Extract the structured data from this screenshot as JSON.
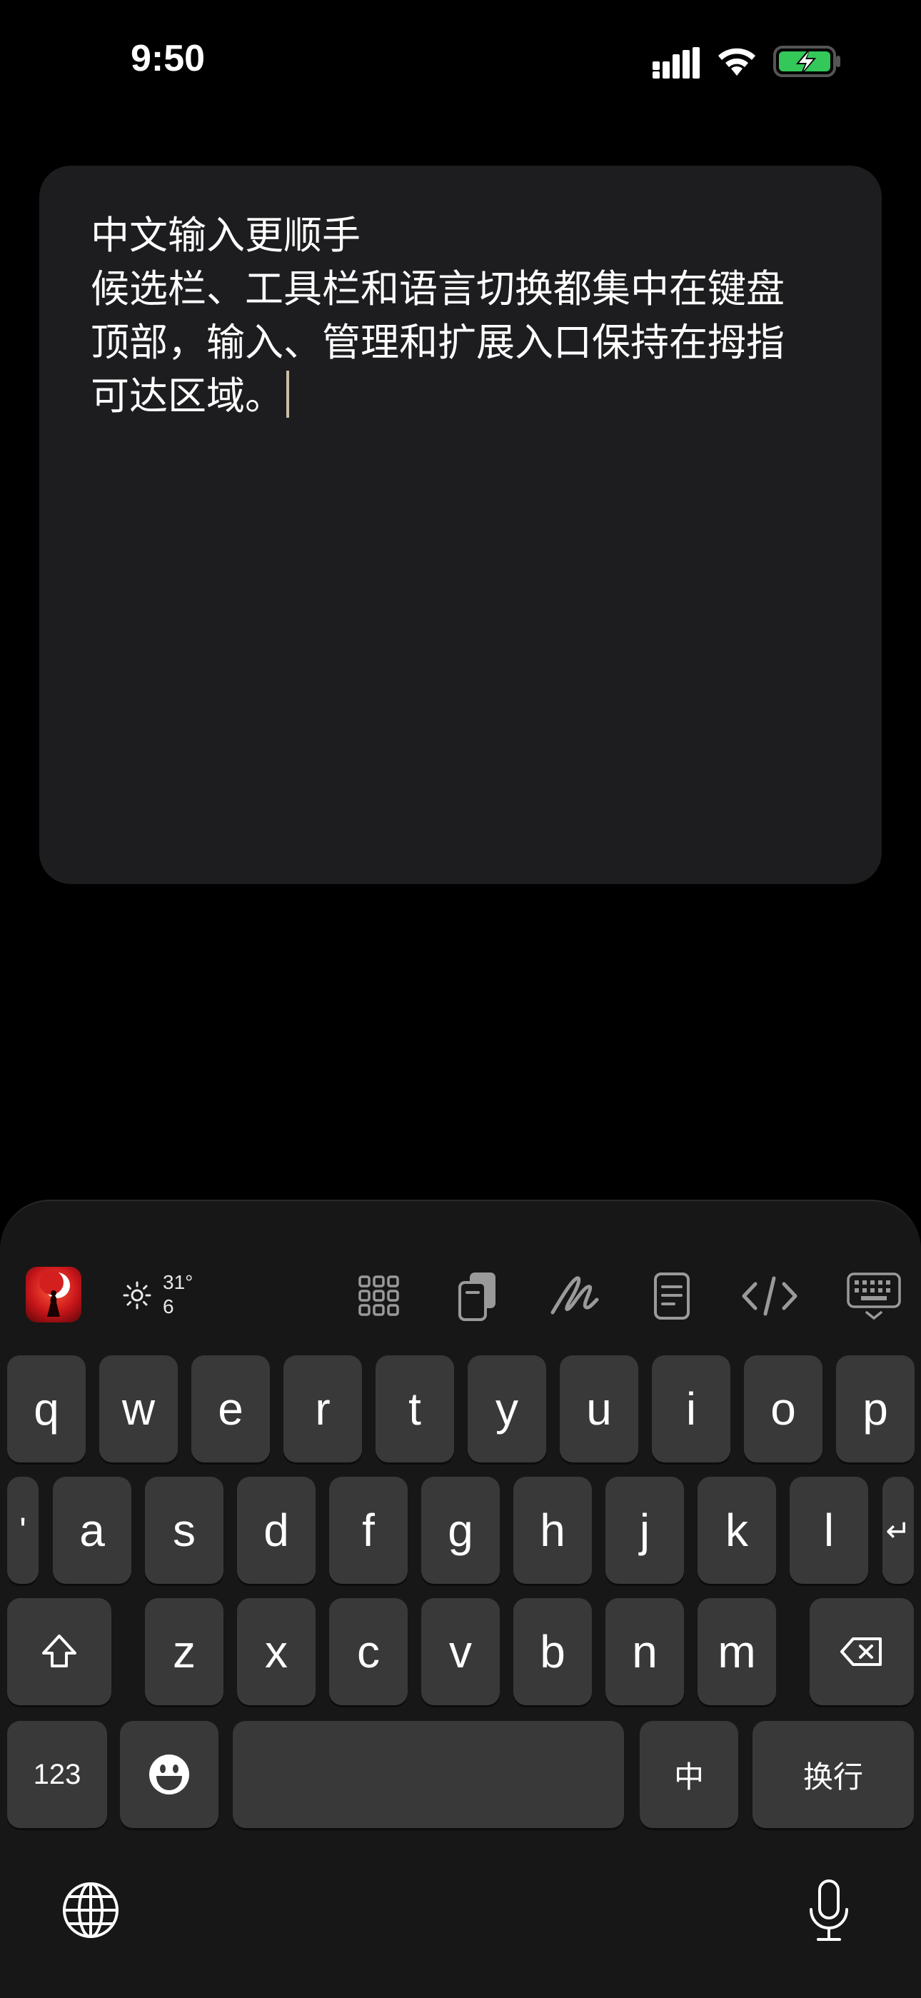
{
  "status_bar": {
    "time": "9:50"
  },
  "editor": {
    "lines": [
      "中文输入更顺手",
      "候选栏、工具栏和语言切换都集中在键盘",
      "顶部，输入、管理和扩展入口保持在拇指",
      "可达区域。"
    ]
  },
  "toolbar": {
    "weather_temp": "31°",
    "weather_num": "6",
    "icons": [
      "app-icon",
      "sun-icon",
      "grid-icon",
      "clipboard-icon",
      "handwriting-icon",
      "document-icon",
      "code-icon",
      "keyboard-hide-icon"
    ]
  },
  "keyboard": {
    "row1": [
      "q",
      "w",
      "e",
      "r",
      "t",
      "y",
      "u",
      "i",
      "o",
      "p"
    ],
    "row2_apostrophe": "'",
    "row2": [
      "a",
      "s",
      "d",
      "f",
      "g",
      "h",
      "j",
      "k",
      "l"
    ],
    "row2_return": "↵",
    "row3": [
      "z",
      "x",
      "c",
      "v",
      "b",
      "n",
      "m"
    ],
    "numbers_label": "123",
    "lang_label": "中",
    "return_label": "换行"
  },
  "colors": {
    "background": "#000000",
    "card": "#1d1d1f",
    "keyboard": "#171717",
    "key": "#393939",
    "battery": "#34c759"
  }
}
